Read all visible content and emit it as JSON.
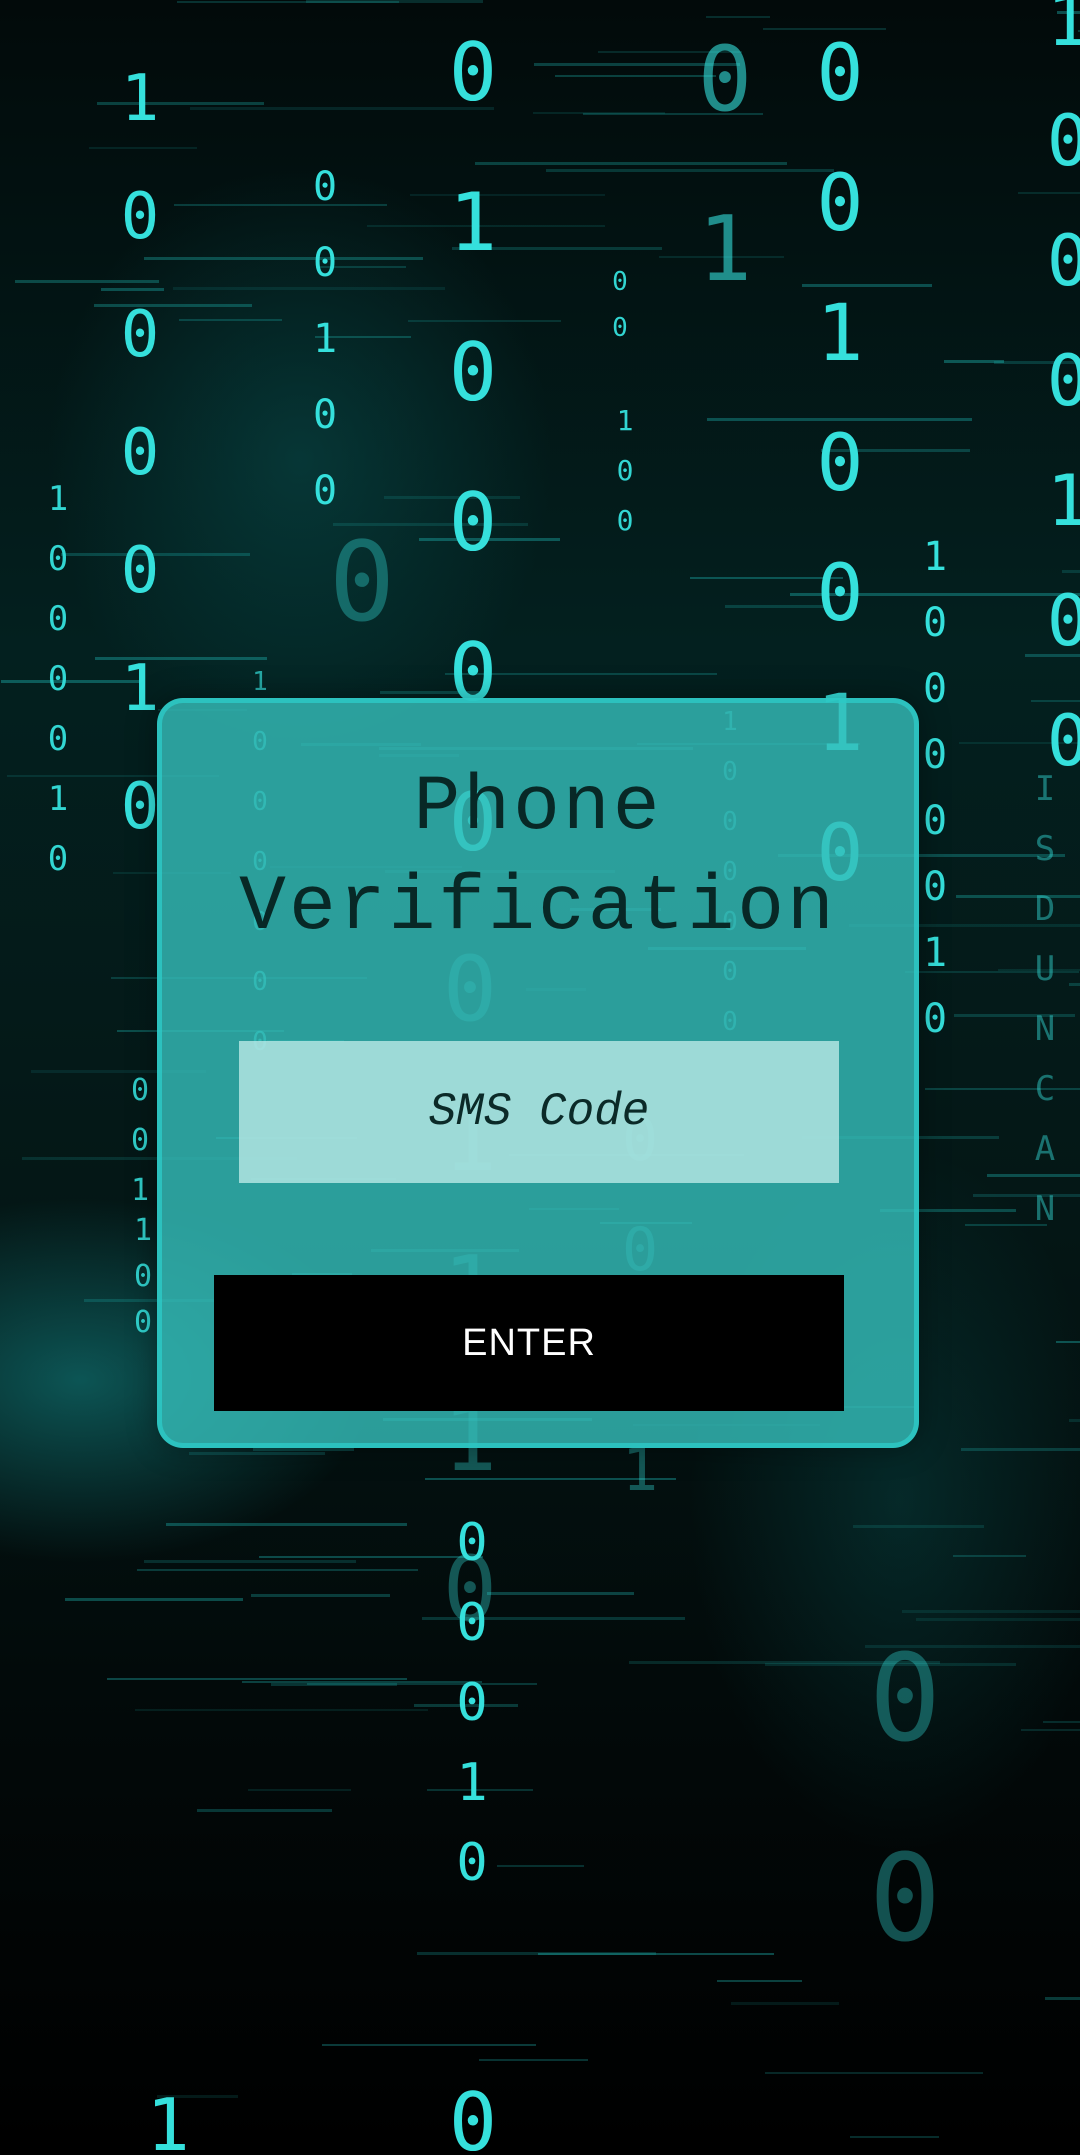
{
  "card": {
    "title_line1": "Phone",
    "title_line2": "Verification"
  },
  "sms_input": {
    "placeholder": "SMS Code",
    "value": ""
  },
  "enter_button": {
    "label": "ENTER"
  },
  "theme": {
    "accent": "#35e0dc",
    "card_background": "#34bcb8",
    "button_background": "#000000",
    "button_text": "#ffffff"
  },
  "background": {
    "binary_glyphs": "1 0"
  }
}
